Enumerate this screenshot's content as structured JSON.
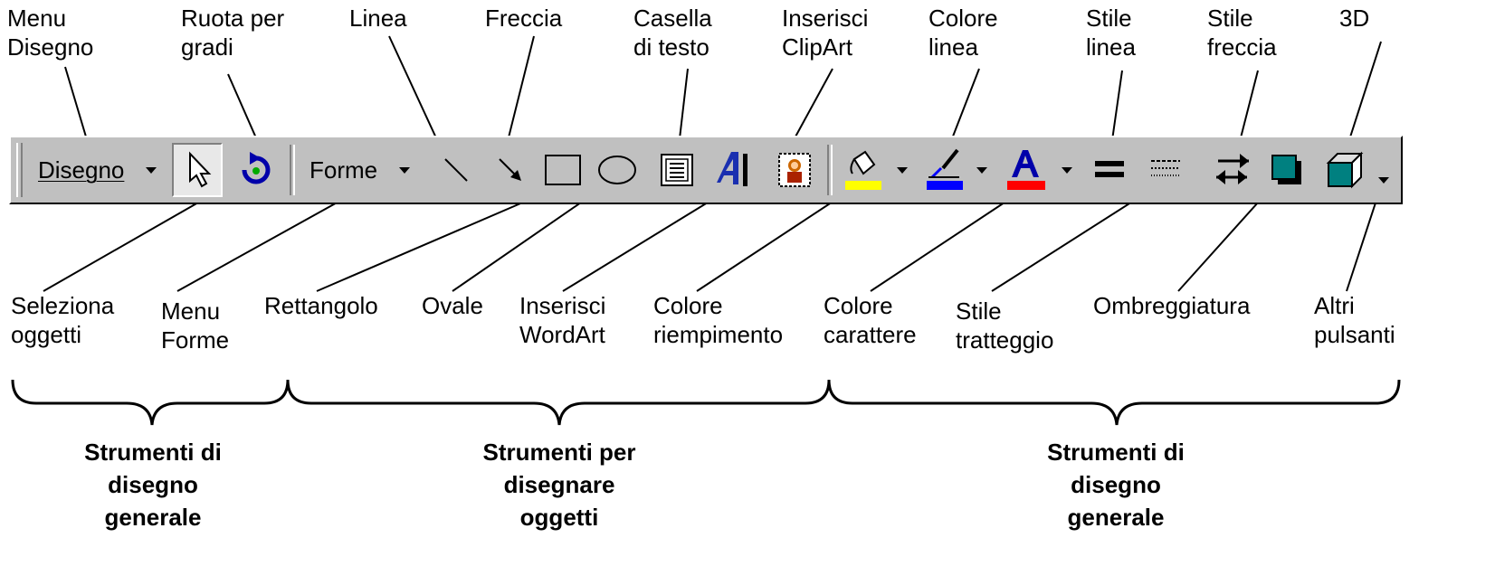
{
  "toolbar": {
    "disegno_label": "Disegno",
    "forme_label": "Forme"
  },
  "labels_top": [
    "Menu\nDisegno",
    "Ruota per\ngradi",
    "Linea",
    "Freccia",
    "Casella\ndi testo",
    "Inserisci\nClipArt",
    "Colore\nlinea",
    "Stile\nlinea",
    "Stile\nfreccia",
    "3D"
  ],
  "labels_bottom": [
    "Seleziona\noggetti",
    "Menu\nForme",
    "Rettangolo",
    "Ovale",
    "Inserisci\nWordArt",
    "Colore\nriempimento",
    "Colore\ncarattere",
    "Stile\ntratteggio",
    "Ombreggiatura",
    "Altri\npulsanti"
  ],
  "groups": [
    "Strumenti di\ndisegno\ngenerale",
    "Strumenti per\ndisegnare\noggetti",
    "Strumenti di\ndisegno\ngenerale"
  ],
  "colors": {
    "toolbar_bg": "#c0c0c0",
    "fill_yellow": "#ffff00",
    "line_blue": "#0000ff",
    "font_red": "#ff0000",
    "teal": "#008080",
    "icon_blue": "#0000aa"
  },
  "icons": [
    "dropdown-arrow-icon",
    "select-pointer-icon",
    "free-rotate-icon",
    "line-tool-icon",
    "arrow-tool-icon",
    "rectangle-icon",
    "oval-icon",
    "text-box-icon",
    "wordart-icon",
    "clipart-icon",
    "fill-color-icon",
    "line-color-icon",
    "font-color-icon",
    "line-style-icon",
    "dash-style-icon",
    "arrow-style-icon",
    "shadow-icon",
    "3d-icon",
    "more-buttons-icon"
  ]
}
